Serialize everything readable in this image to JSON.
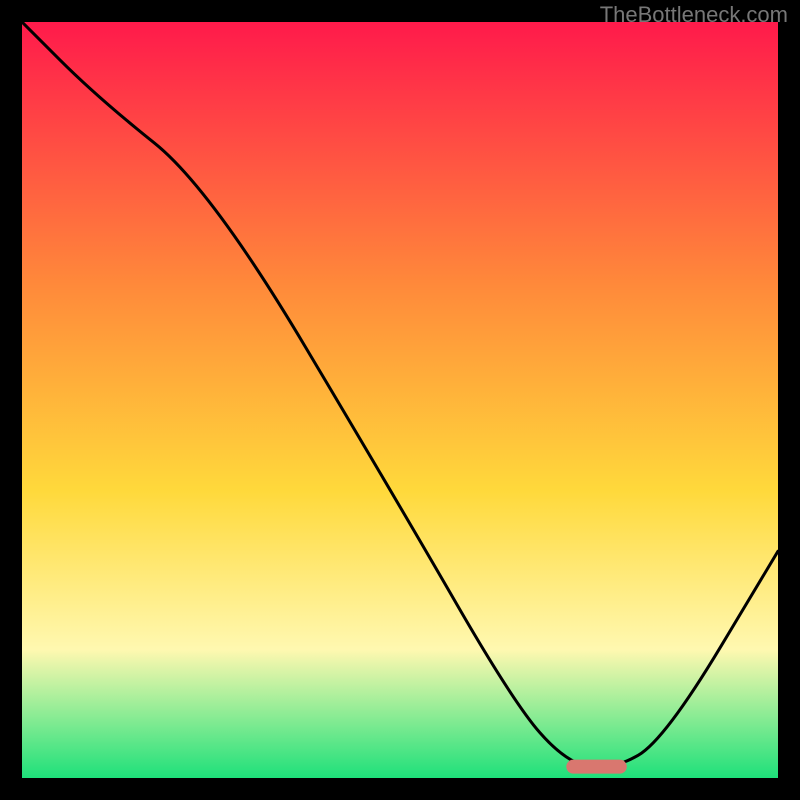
{
  "watermark": "TheBottleneck.com",
  "chart_data": {
    "type": "line",
    "title": "",
    "xlabel": "",
    "ylabel": "",
    "xlim": [
      0,
      100
    ],
    "ylim": [
      0,
      100
    ],
    "grid": false,
    "legend": false,
    "series": [
      {
        "name": "curve",
        "x": [
          0,
          10,
          25,
          50,
          65,
          72,
          78,
          85,
          100
        ],
        "y": [
          100,
          90,
          78,
          36,
          10,
          2,
          1,
          5,
          30
        ]
      }
    ],
    "marker": {
      "name": "highlight-bar",
      "x_range": [
        72,
        80
      ],
      "y": 1.5,
      "color": "#d9776f"
    },
    "background_gradient": {
      "top": "#ff1a4b",
      "mid1": "#ff8a3a",
      "mid2": "#ffd93b",
      "mid3": "#fff8b0",
      "bottom": "#1ee07a"
    }
  }
}
